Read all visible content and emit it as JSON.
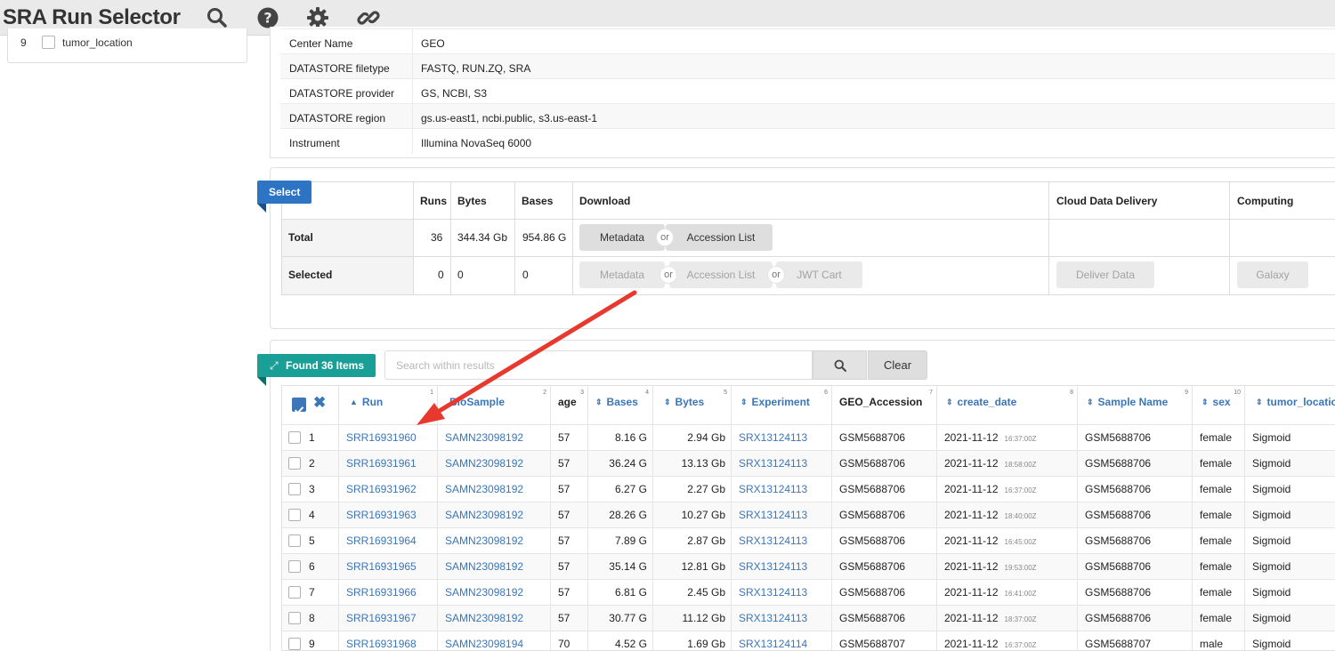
{
  "app": {
    "title": "SRA Run Selector"
  },
  "toolbar": {
    "icons": [
      "search-icon",
      "help-icon",
      "gear-icon",
      "link-icon"
    ]
  },
  "facet": {
    "number": "9",
    "label": "tumor_location"
  },
  "metadata": [
    {
      "key": "Center Name",
      "value": "GEO"
    },
    {
      "key": "DATASTORE filetype",
      "value": "FASTQ, RUN.ZQ, SRA"
    },
    {
      "key": "DATASTORE provider",
      "value": "GS, NCBI, S3"
    },
    {
      "key": "DATASTORE region",
      "value": "gs.us-east1, ncbi.public, s3.us-east-1"
    },
    {
      "key": "Instrument",
      "value": "Illumina NovaSeq 6000"
    }
  ],
  "select": {
    "ribbon": "Select",
    "headers": {
      "runs": "Runs",
      "bytes": "Bytes",
      "bases": "Bases",
      "download": "Download",
      "cloud": "Cloud Data Delivery",
      "computing": "Computing"
    },
    "total": {
      "label": "Total",
      "runs": "36",
      "bytes": "344.34 Gb",
      "bases": "954.86 G",
      "metadata_btn": "Metadata",
      "or": "or",
      "accession_btn": "Accession List"
    },
    "selected": {
      "label": "Selected",
      "runs": "0",
      "bytes": "0",
      "bases": "0",
      "metadata_btn": "Metadata",
      "or": "or",
      "accession_btn": "Accession List",
      "jwt_btn": "JWT Cart",
      "deliver_btn": "Deliver Data",
      "galaxy_btn": "Galaxy"
    }
  },
  "found": {
    "ribbon": "Found 36 Items",
    "search_placeholder": "Search within results",
    "clear_label": "Clear"
  },
  "columns": [
    {
      "label": "Run",
      "index": "1",
      "sort": "▲"
    },
    {
      "label": "BioSample",
      "index": "2",
      "sort": ""
    },
    {
      "label": "age",
      "index": "3",
      "sort": ""
    },
    {
      "label": "Bases",
      "index": "4",
      "sort": "⇕"
    },
    {
      "label": "Bytes",
      "index": "5",
      "sort": "⇕"
    },
    {
      "label": "Experiment",
      "index": "6",
      "sort": "⇕"
    },
    {
      "label": "GEO_Accession",
      "index": "7",
      "sort": ""
    },
    {
      "label": "create_date",
      "index": "8",
      "sort": "⇕"
    },
    {
      "label": "Sample Name",
      "index": "9",
      "sort": "⇕"
    },
    {
      "label": "sex",
      "index": "10",
      "sort": "⇕"
    },
    {
      "label": "tumor_location",
      "index": "",
      "sort": "⇕"
    }
  ],
  "rows": [
    {
      "n": "1",
      "run": "SRR16931960",
      "biosample": "SAMN23098192",
      "age": "57",
      "bases": "8.16 G",
      "bytes": "2.94 Gb",
      "experiment": "SRX13124113",
      "geo": "GSM5688706",
      "date": "2021-11-12",
      "time": "16:37:00Z",
      "sample": "GSM5688706",
      "sex": "female",
      "tumor": "Sigmoid"
    },
    {
      "n": "2",
      "run": "SRR16931961",
      "biosample": "SAMN23098192",
      "age": "57",
      "bases": "36.24 G",
      "bytes": "13.13 Gb",
      "experiment": "SRX13124113",
      "geo": "GSM5688706",
      "date": "2021-11-12",
      "time": "18:58:00Z",
      "sample": "GSM5688706",
      "sex": "female",
      "tumor": "Sigmoid"
    },
    {
      "n": "3",
      "run": "SRR16931962",
      "biosample": "SAMN23098192",
      "age": "57",
      "bases": "6.27 G",
      "bytes": "2.27 Gb",
      "experiment": "SRX13124113",
      "geo": "GSM5688706",
      "date": "2021-11-12",
      "time": "16:37:00Z",
      "sample": "GSM5688706",
      "sex": "female",
      "tumor": "Sigmoid"
    },
    {
      "n": "4",
      "run": "SRR16931963",
      "biosample": "SAMN23098192",
      "age": "57",
      "bases": "28.26 G",
      "bytes": "10.27 Gb",
      "experiment": "SRX13124113",
      "geo": "GSM5688706",
      "date": "2021-11-12",
      "time": "18:40:00Z",
      "sample": "GSM5688706",
      "sex": "female",
      "tumor": "Sigmoid"
    },
    {
      "n": "5",
      "run": "SRR16931964",
      "biosample": "SAMN23098192",
      "age": "57",
      "bases": "7.89 G",
      "bytes": "2.87 Gb",
      "experiment": "SRX13124113",
      "geo": "GSM5688706",
      "date": "2021-11-12",
      "time": "16:45:00Z",
      "sample": "GSM5688706",
      "sex": "female",
      "tumor": "Sigmoid"
    },
    {
      "n": "6",
      "run": "SRR16931965",
      "biosample": "SAMN23098192",
      "age": "57",
      "bases": "35.14 G",
      "bytes": "12.81 Gb",
      "experiment": "SRX13124113",
      "geo": "GSM5688706",
      "date": "2021-11-12",
      "time": "19:53:00Z",
      "sample": "GSM5688706",
      "sex": "female",
      "tumor": "Sigmoid"
    },
    {
      "n": "7",
      "run": "SRR16931966",
      "biosample": "SAMN23098192",
      "age": "57",
      "bases": "6.81 G",
      "bytes": "2.45 Gb",
      "experiment": "SRX13124113",
      "geo": "GSM5688706",
      "date": "2021-11-12",
      "time": "16:41:00Z",
      "sample": "GSM5688706",
      "sex": "female",
      "tumor": "Sigmoid"
    },
    {
      "n": "8",
      "run": "SRR16931967",
      "biosample": "SAMN23098192",
      "age": "57",
      "bases": "30.77 G",
      "bytes": "11.12 Gb",
      "experiment": "SRX13124113",
      "geo": "GSM5688706",
      "date": "2021-11-12",
      "time": "18:37:00Z",
      "sample": "GSM5688706",
      "sex": "female",
      "tumor": "Sigmoid"
    },
    {
      "n": "9",
      "run": "SRR16931968",
      "biosample": "SAMN23098194",
      "age": "70",
      "bases": "4.52 G",
      "bytes": "1.69 Gb",
      "experiment": "SRX13124114",
      "geo": "GSM5688707",
      "date": "2021-11-12",
      "time": "16:37:00Z",
      "sample": "GSM5688707",
      "sex": "male",
      "tumor": "Sigmoid"
    }
  ],
  "colors": {
    "link": "#3a76b8",
    "select_ribbon": "#2d74c4",
    "found_ribbon": "#1a9f96",
    "annotation_arrow": "#e8392e"
  }
}
